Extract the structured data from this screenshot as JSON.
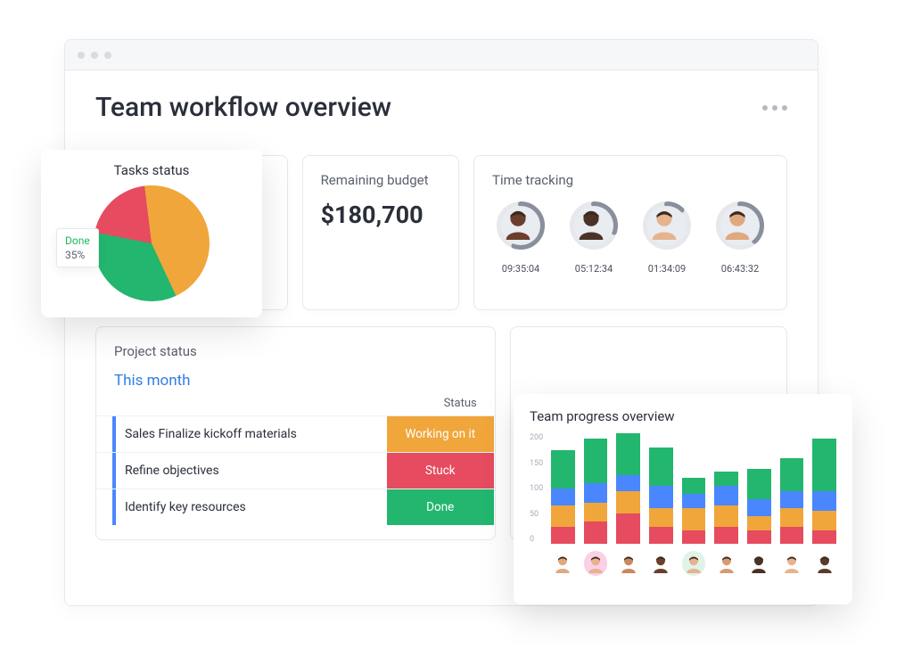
{
  "header": {
    "title": "Team workflow overview"
  },
  "tasks_status": {
    "title": "Tasks status",
    "tooltip_label": "Done",
    "tooltip_value": "35%"
  },
  "budget": {
    "title": "Remaining budget",
    "value": "$180,700"
  },
  "time_tracking": {
    "title": "Time tracking",
    "entries": [
      {
        "time": "09:35:04",
        "progress": 55,
        "skin": "#6b3e2e"
      },
      {
        "time": "05:12:34",
        "progress": 30,
        "skin": "#4a3326"
      },
      {
        "time": "01:34:09",
        "progress": 12,
        "skin": "#e6b38f"
      },
      {
        "time": "06:43:32",
        "progress": 38,
        "skin": "#e0a87d"
      }
    ]
  },
  "project_status": {
    "title": "Project status",
    "period": "This month",
    "status_header": "Status",
    "rows": [
      {
        "name": "Sales Finalize kickoff materials",
        "status": "Working on it",
        "color": "#f0a63b"
      },
      {
        "name": "Refine objectives",
        "status": "Stuck",
        "color": "#e64b5f"
      },
      {
        "name": "Identify key resources",
        "status": "Done",
        "color": "#22b66e"
      }
    ]
  },
  "team_progress": {
    "title": "Team progress overview",
    "y_ticks": [
      "200",
      "150",
      "100",
      "50",
      "0"
    ],
    "max": 200,
    "members": [
      {
        "skin": "#e0a87d",
        "bg": "#ffffff"
      },
      {
        "skin": "#e6b38f",
        "bg": "#fbcfe5"
      },
      {
        "skin": "#c78a60",
        "bg": "#ffffff"
      },
      {
        "skin": "#6b3e2e",
        "bg": "#ffffff"
      },
      {
        "skin": "#e6b38f",
        "bg": "#e0f3e6"
      },
      {
        "skin": "#d89a72",
        "bg": "#ffffff"
      },
      {
        "skin": "#4a3326",
        "bg": "#ffffff"
      },
      {
        "skin": "#e6b38f",
        "bg": "#ffffff"
      },
      {
        "skin": "#5a3b2a",
        "bg": "#ffffff"
      }
    ]
  },
  "colors": {
    "green": "#22b66e",
    "orange": "#f0a63b",
    "red": "#e64b5f",
    "blue": "#4a87ff",
    "ring_bg": "#e6e8ec"
  },
  "chart_data": [
    {
      "type": "pie",
      "title": "Tasks status",
      "categories": [
        "Done",
        "Stuck",
        "Working on it"
      ],
      "values": [
        35,
        20,
        45
      ],
      "colors": [
        "#22b66e",
        "#e64b5f",
        "#f0a63b"
      ]
    },
    {
      "type": "bar",
      "title": "Team progress overview",
      "stacked": true,
      "ylim": [
        0,
        200
      ],
      "ylabel": "",
      "xlabel": "",
      "categories": [
        "1",
        "2",
        "3",
        "4",
        "5",
        "6",
        "7",
        "8",
        "9"
      ],
      "series": [
        {
          "name": "red",
          "color": "#e64b5f",
          "values": [
            30,
            40,
            55,
            30,
            25,
            30,
            25,
            30,
            25
          ]
        },
        {
          "name": "orange",
          "color": "#f0a63b",
          "values": [
            40,
            35,
            40,
            35,
            40,
            40,
            25,
            35,
            35
          ]
        },
        {
          "name": "blue",
          "color": "#4a87ff",
          "values": [
            30,
            35,
            30,
            40,
            25,
            35,
            30,
            30,
            35
          ]
        },
        {
          "name": "green",
          "color": "#22b66e",
          "values": [
            70,
            80,
            75,
            70,
            30,
            25,
            55,
            60,
            95
          ]
        }
      ]
    }
  ]
}
